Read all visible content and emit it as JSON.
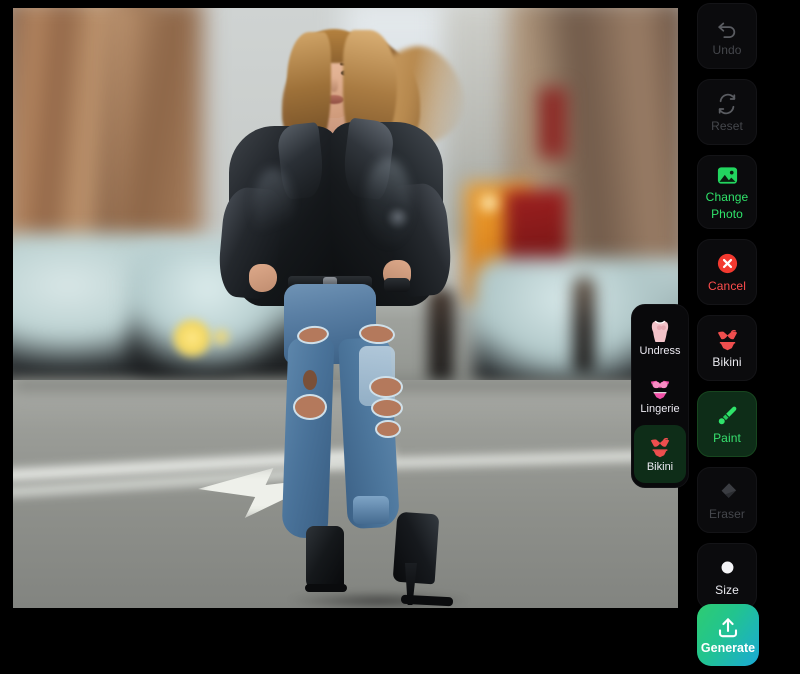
{
  "app": {
    "background_color": "#000000",
    "canvas_background": "#2b2b28"
  },
  "canvas": {
    "name": "photo-canvas",
    "description": "Full-body photo of a woman standing in a blurred city street wearing a black leather jacket, peach top, ripped blue jeans and black high-heeled boots"
  },
  "toolbar_main": {
    "buttons": [
      {
        "label": "Undo",
        "icon": "undo-icon",
        "state": "disabled",
        "color": "#45474c"
      },
      {
        "label": "Reset",
        "icon": "reset-icon",
        "state": "disabled",
        "color": "#45474c"
      },
      {
        "label": "Change Photo",
        "label_line1": "Change",
        "label_line2": "Photo",
        "icon": "image-icon",
        "state": "enabled",
        "color": "#2fe36a"
      },
      {
        "label": "Cancel",
        "icon": "cancel-icon",
        "state": "enabled",
        "color": "#ff4d4d"
      },
      {
        "label": "Bikini",
        "icon": "bikini-icon",
        "state": "enabled",
        "color": "#eceaf2"
      },
      {
        "label": "Paint",
        "icon": "paint-brush-icon",
        "state": "selected",
        "color": "#37e06e"
      },
      {
        "label": "Eraser",
        "icon": "eraser-icon",
        "state": "disabled",
        "color": "#45474c"
      },
      {
        "label": "Size",
        "icon": "brush-size-dot-icon",
        "state": "enabled",
        "color": "#eceaf2"
      }
    ]
  },
  "toolbar_modes": {
    "buttons": [
      {
        "label": "Undress",
        "icon": "undress-torso-icon",
        "state": "enabled",
        "icon_color": "#f0b9c2"
      },
      {
        "label": "Lingerie",
        "icon": "lingerie-icon",
        "state": "enabled",
        "icon_color": "#ef4fa6"
      },
      {
        "label": "Bikini",
        "icon": "bikini-icon",
        "state": "selected",
        "icon_color": "#ef4e4e"
      }
    ]
  },
  "generate": {
    "label": "Generate",
    "icon": "upload-arrow-icon",
    "gradient_from": "#2ecc71",
    "gradient_to": "#1aa9d6"
  }
}
